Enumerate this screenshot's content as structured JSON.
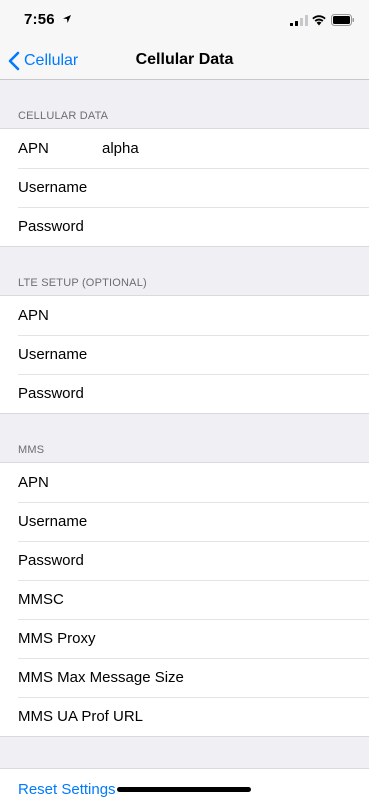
{
  "status_bar": {
    "time": "7:56",
    "icons": [
      "location-arrow-icon",
      "cellular-signal-icon",
      "wifi-icon",
      "battery-icon"
    ]
  },
  "nav": {
    "back_label": "Cellular",
    "title": "Cellular Data"
  },
  "sections": {
    "cellular_data": {
      "header": "CELLULAR DATA",
      "rows": [
        {
          "label": "APN",
          "value": "alpha"
        },
        {
          "label": "Username",
          "value": ""
        },
        {
          "label": "Password",
          "value": ""
        }
      ]
    },
    "lte_setup": {
      "header": "LTE SETUP (OPTIONAL)",
      "rows": [
        {
          "label": "APN",
          "value": ""
        },
        {
          "label": "Username",
          "value": ""
        },
        {
          "label": "Password",
          "value": ""
        }
      ]
    },
    "mms": {
      "header": "MMS",
      "rows": [
        {
          "label": "APN",
          "value": ""
        },
        {
          "label": "Username",
          "value": ""
        },
        {
          "label": "Password",
          "value": ""
        },
        {
          "label": "MMSC",
          "value": ""
        },
        {
          "label": "MMS Proxy",
          "value": ""
        },
        {
          "label": "MMS Max Message Size",
          "value": ""
        },
        {
          "label": "MMS UA Prof URL",
          "value": ""
        }
      ]
    }
  },
  "reset_label": "Reset Settings",
  "colors": {
    "accent": "#007aff",
    "background": "#efeff4"
  }
}
